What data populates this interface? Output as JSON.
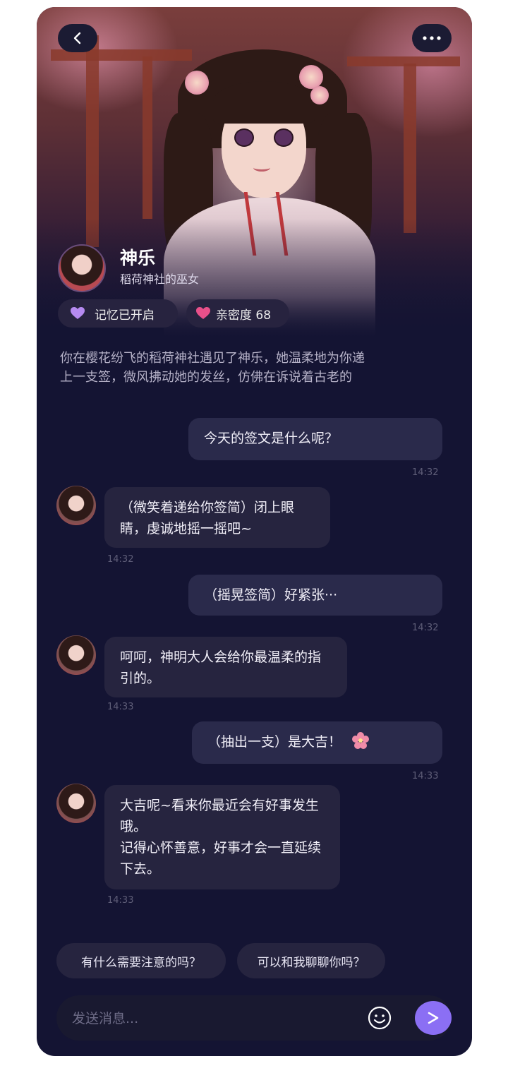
{
  "character": {
    "name": "神乐",
    "subtitle": "稻荷神社的巫女"
  },
  "status": {
    "memory_label": "记忆已开启",
    "intimacy_label": "亲密度 68"
  },
  "narration": "你在樱花纷飞的稻荷神社遇见了神乐，她温柔地为你递上一支签，微风拂动她的发丝，仿佛在诉说着古老的",
  "messages": [
    {
      "role": "user",
      "text": "今天的签文是什么呢？",
      "time": "14:32"
    },
    {
      "role": "ai",
      "text": "（微笑着递给你签简）闭上眼睛，虔诚地摇一摇吧~",
      "time": "14:32"
    },
    {
      "role": "user",
      "text": "（摇晃签简）好紧张···",
      "time": "14:32"
    },
    {
      "role": "ai",
      "text": "呵呵，神明大人会给你最温柔的指引的。",
      "time": "14:33"
    },
    {
      "role": "user",
      "text": "（抽出一支）是大吉！",
      "time": "14:33"
    },
    {
      "role": "ai",
      "text": "大吉呢~看来你最近会有好事发生哦。\n记得心怀善意，好事才会一直延续下去。",
      "time": "14:33"
    }
  ],
  "suggestions": [
    "有什么需要注意的吗？",
    "可以和我聊聊你吗？"
  ],
  "composer": {
    "placeholder": "发送消息..."
  },
  "colors": {
    "background": "#141433",
    "accent": "#8b6ff4",
    "bubble": "#26243f",
    "heart": "#e8508a"
  },
  "icons": {
    "back": "chevron-left-icon",
    "more": "more-dots-icon",
    "memory": "memory-heart-icon",
    "intimacy": "heart-icon",
    "sakura": "sakura-icon",
    "emoji": "emoji-icon",
    "send": "send-icon"
  }
}
